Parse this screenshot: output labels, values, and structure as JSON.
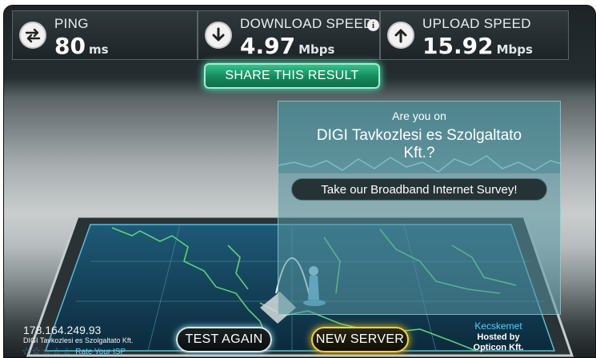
{
  "stats": {
    "ping": {
      "label": "PING",
      "value": "80",
      "unit": "ms",
      "icon": "ping-arrows-icon"
    },
    "download": {
      "label": "DOWNLOAD SPEED",
      "value": "4.97",
      "unit": "Mbps",
      "icon": "download-arrow-icon",
      "info": "i"
    },
    "upload": {
      "label": "UPLOAD SPEED",
      "value": "15.92",
      "unit": "Mbps",
      "icon": "upload-arrow-icon"
    }
  },
  "share": {
    "label": "SHARE THIS RESULT"
  },
  "survey": {
    "question": "Are you on",
    "isp_line1": "DIGI Tavkozlesi es Szolgaltato",
    "isp_line2": "Kft.?",
    "button": "Take our Broadband Internet Survey!"
  },
  "client": {
    "ip": "178.164.249.93",
    "isp": "DIGI Tavkozlesi es Szolgaltato Kft.",
    "rating_stars": 0,
    "rating_max": 5,
    "rate_label": "Rate Your ISP"
  },
  "buttons": {
    "test_again": "TEST AGAIN",
    "new_server": "NEW SERVER"
  },
  "server": {
    "city": "Kecskemet",
    "hosted_by": "Hosted by",
    "host": "Opticon Kft."
  },
  "colors": {
    "accent_green": "#138a5c",
    "accent_gold": "#f0d23a",
    "accent_cyan": "#4fd0ff",
    "panel_teal": "#5896a0"
  }
}
